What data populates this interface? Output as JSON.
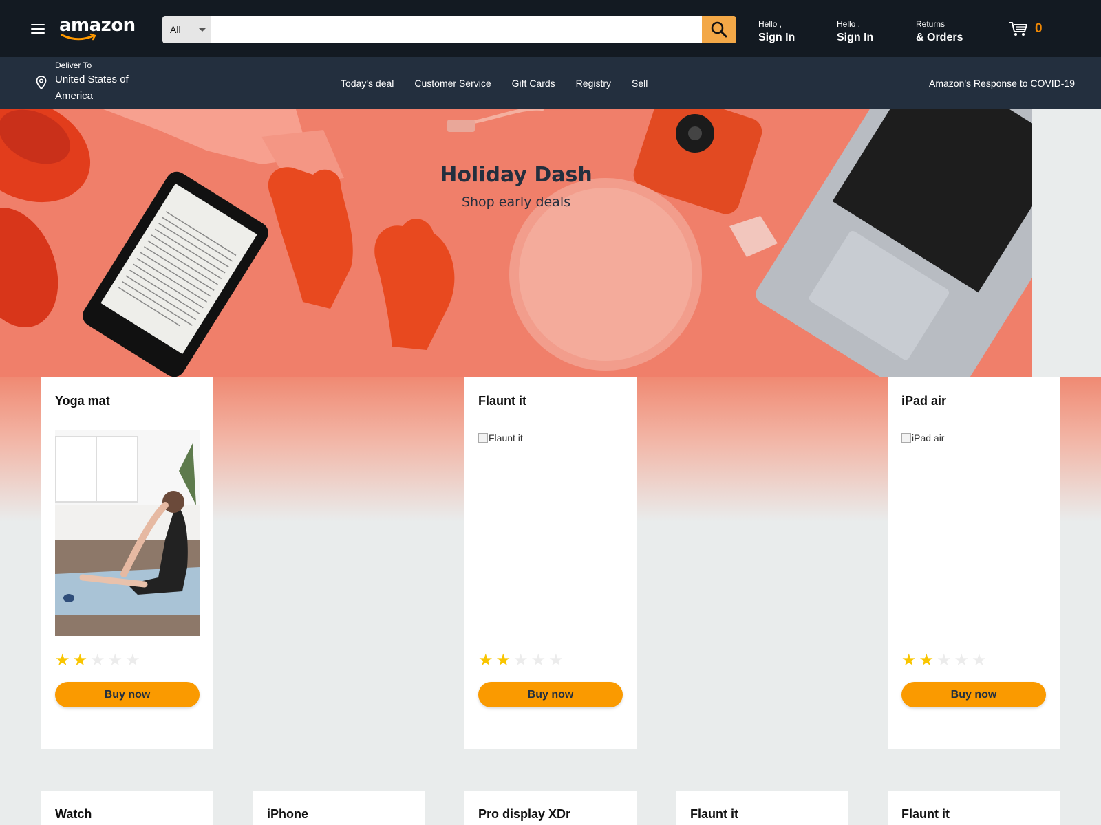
{
  "header": {
    "logo": "amazon",
    "search_category": "All",
    "search_placeholder": "",
    "accounts": [
      {
        "line1": "Hello ,",
        "line2": "Sign In"
      },
      {
        "line1": "Hello ,",
        "line2": "Sign In"
      }
    ],
    "returns": {
      "line1": "Returns",
      "line2": "& Orders"
    },
    "cart_count": "0"
  },
  "subnav": {
    "deliver_label": "Deliver To",
    "deliver_location": "United States of America",
    "links": [
      "Today's deal",
      "Customer Service",
      "Gift Cards",
      "Registry",
      "Sell"
    ],
    "covid": "Amazon's Response to COVID-19"
  },
  "hero": {
    "title": "Holiday Dash",
    "subtitle": "Shop early deals"
  },
  "products": [
    {
      "title": "Yoga mat",
      "image_alt": "",
      "rating": 2,
      "button": "Buy now"
    },
    {
      "title": "Flaunt it",
      "image_alt": "Flaunt it",
      "rating": 2,
      "button": "Buy now"
    },
    {
      "title": "iPad air",
      "image_alt": "iPad air",
      "rating": 2,
      "button": "Buy now"
    }
  ],
  "products_row2": [
    {
      "title": "Watch"
    },
    {
      "title": "iPhone"
    },
    {
      "title": "Pro display XDr"
    },
    {
      "title": "Flaunt it"
    },
    {
      "title": "Flaunt it"
    }
  ],
  "colors": {
    "topbar": "#131a22",
    "subnav": "#232f3e",
    "search_button": "#f3a847",
    "buy_button": "#fa9a00",
    "star": "#f9c500",
    "hero": "#f07f6a"
  },
  "icons": {
    "menu": "hamburger-icon",
    "search": "search-icon",
    "cart": "cart-icon",
    "location": "location-pin-icon"
  }
}
